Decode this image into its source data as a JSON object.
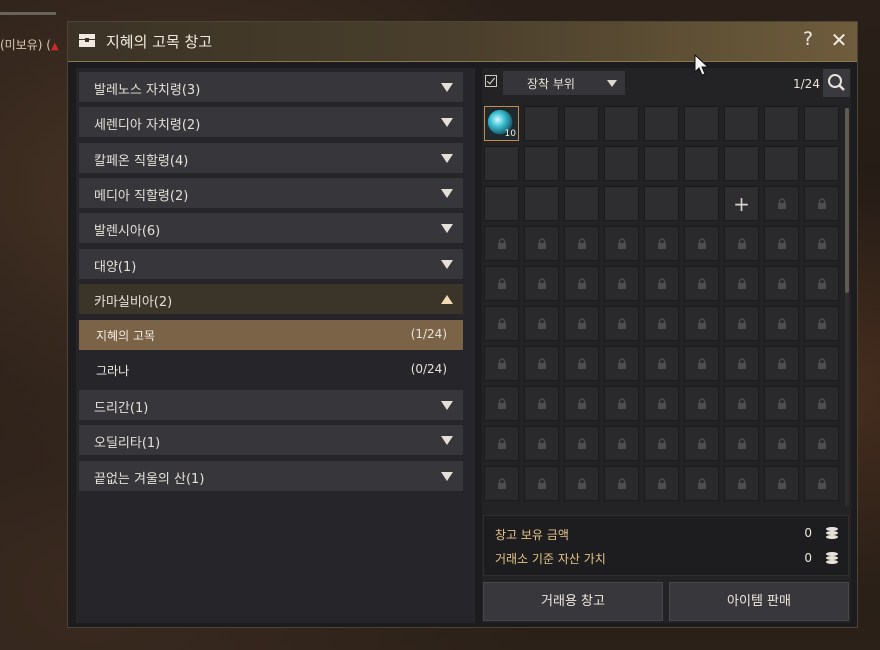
{
  "background": {
    "status_text": "(미보유) ("
  },
  "window": {
    "title": "지혜의 고목 창고",
    "help_label": "?",
    "close_label": "✕"
  },
  "regions": [
    {
      "label": "발레노스 자치령(3)",
      "expanded": false
    },
    {
      "label": "세렌디아 자치령(2)",
      "expanded": false
    },
    {
      "label": "칼페온 직할령(4)",
      "expanded": false
    },
    {
      "label": "메디아 직할령(2)",
      "expanded": false
    },
    {
      "label": "발렌시아(6)",
      "expanded": false
    },
    {
      "label": "대양(1)",
      "expanded": false
    },
    {
      "label": "카마실비아(2)",
      "expanded": true
    },
    {
      "label": "드리간(1)",
      "expanded": false
    },
    {
      "label": "오딜리타(1)",
      "expanded": false
    },
    {
      "label": "끝없는 겨울의 산(1)",
      "expanded": false
    }
  ],
  "sub_items": [
    {
      "label": "지혜의 고목",
      "count": "(1/24)",
      "selected": true
    },
    {
      "label": "그라나",
      "count": "(0/24)",
      "selected": false
    }
  ],
  "inventory": {
    "filter_label": "장착 부위",
    "filter_checked": true,
    "capacity": "1/24",
    "item_stack": "10",
    "open_slots": 24,
    "expand_slot_label": "+"
  },
  "money": {
    "stored_label": "창고 보유 금액",
    "stored_value": "0",
    "market_label": "거래소 기준 자산 가치",
    "market_value": "0"
  },
  "buttons": {
    "trade_storage": "거래용 창고",
    "sell_items": "아이템 판매"
  },
  "colors": {
    "selected_bg": "#7b6347",
    "gold_text": "#e2c48a",
    "item_border": "#c58a4c"
  }
}
